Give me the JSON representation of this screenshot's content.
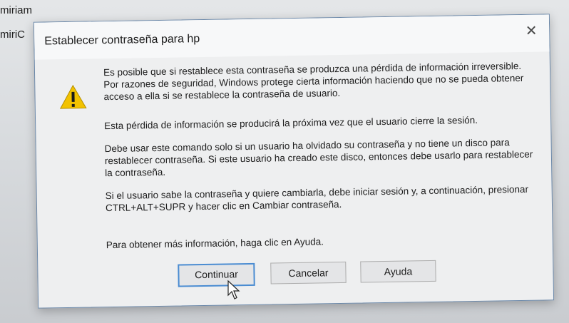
{
  "background": {
    "user_label": "miriam",
    "user_label_2": "miriC"
  },
  "dialog": {
    "title": "Establecer contraseña para hp",
    "close_glyph": "✕",
    "paragraphs": [
      "Es posible que si restablece esta contraseña se produzca una pérdida de información irreversible. Por razones de seguridad, Windows protege cierta información haciendo que no se pueda obtener acceso a ella si se restablece la contraseña de usuario.",
      "Esta pérdida de información se producirá la próxima vez que el usuario cierre la sesión.",
      "Debe usar este comando solo si un usuario ha olvidado su contraseña y no tiene un disco para restablecer contraseña. Si este usuario ha creado este disco, entonces debe usarlo para restablecer la contraseña.",
      "Si el usuario sabe la contraseña y quiere cambiarla, debe iniciar sesión y, a continuación, presionar CTRL+ALT+SUPR y hacer clic en Cambiar contraseña.",
      "Para obtener más información, haga clic en Ayuda."
    ],
    "buttons": {
      "continue": "Continuar",
      "cancel": "Cancelar",
      "help": "Ayuda"
    },
    "icon": "warning-icon",
    "colors": {
      "warning_fill": "#f2c200",
      "focus_border": "#4a8cd2"
    }
  }
}
